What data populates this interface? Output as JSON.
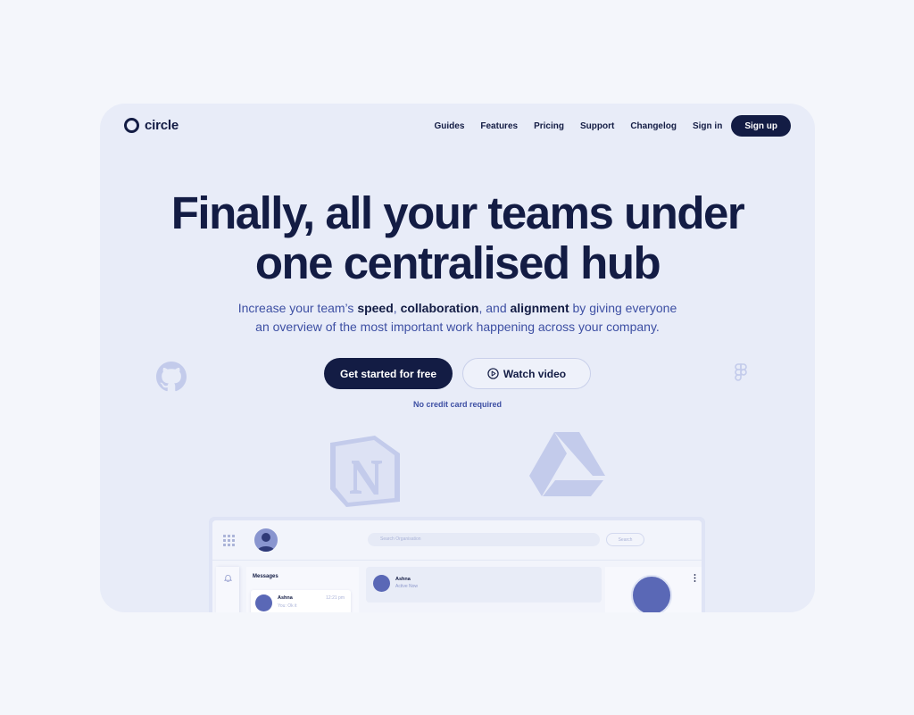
{
  "brand": {
    "name": "circle"
  },
  "nav": {
    "links": [
      "Guides",
      "Features",
      "Pricing",
      "Support",
      "Changelog",
      "Sign in"
    ],
    "signup_label": "Sign up"
  },
  "hero": {
    "headline_line1": "Finally, all your teams under",
    "headline_line2": "one centralised hub",
    "sub": {
      "p1": "Increase your team’s ",
      "b1": "speed",
      "p2": ", ",
      "b2": "collaboration",
      "p3": ", and ",
      "b3": "alignment",
      "p4": " by giving everyone",
      "line2": "an overview of the most important work happening across your company."
    },
    "cta_primary": "Get started for free",
    "cta_secondary": "Watch video",
    "note": "No credit card required"
  },
  "decor_icons": [
    "github-icon",
    "figma-icon",
    "notion-icon",
    "google-drive-icon"
  ],
  "preview": {
    "search_placeholder": "Search Organisation",
    "search_button": "Search",
    "messages_title": "Messages",
    "message": {
      "name": "Ashna",
      "time": "12:21 pm",
      "text": "You: Ok it"
    },
    "chat": {
      "name": "Ashna",
      "status": "Active Now"
    }
  },
  "colors": {
    "page_bg": "#f4f6fb",
    "card_bg": "#e8ecf8",
    "navy": "#131c44",
    "accent_blue": "#3d4fa3",
    "decor": "#c3cbeb"
  }
}
